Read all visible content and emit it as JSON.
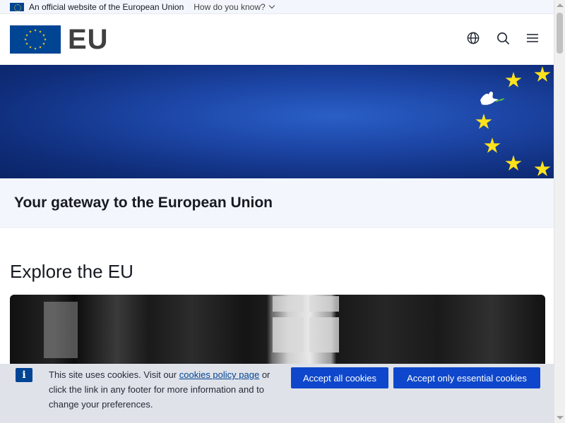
{
  "banner": {
    "official_text": "An official website of the European Union",
    "how_link": "How do you know?"
  },
  "header": {
    "logo_text": "EU",
    "icons": [
      "globe-icon",
      "search-icon",
      "menu-icon"
    ]
  },
  "hero": {
    "tagline": "Your gateway to the European Union"
  },
  "explore": {
    "title": "Explore the EU"
  },
  "cookies": {
    "text_before_link": "This site uses cookies. Visit our ",
    "link_text": "cookies policy page",
    "text_after_link": " or click the link in any footer for more information and to change your preferences.",
    "accept_all": "Accept all cookies",
    "accept_essential": "Accept only essential cookies"
  },
  "colors": {
    "eu_blue": "#004494",
    "star_yellow": "#ffd617",
    "button_blue": "#0e47cb",
    "banner_bg": "#f3f6fc"
  }
}
